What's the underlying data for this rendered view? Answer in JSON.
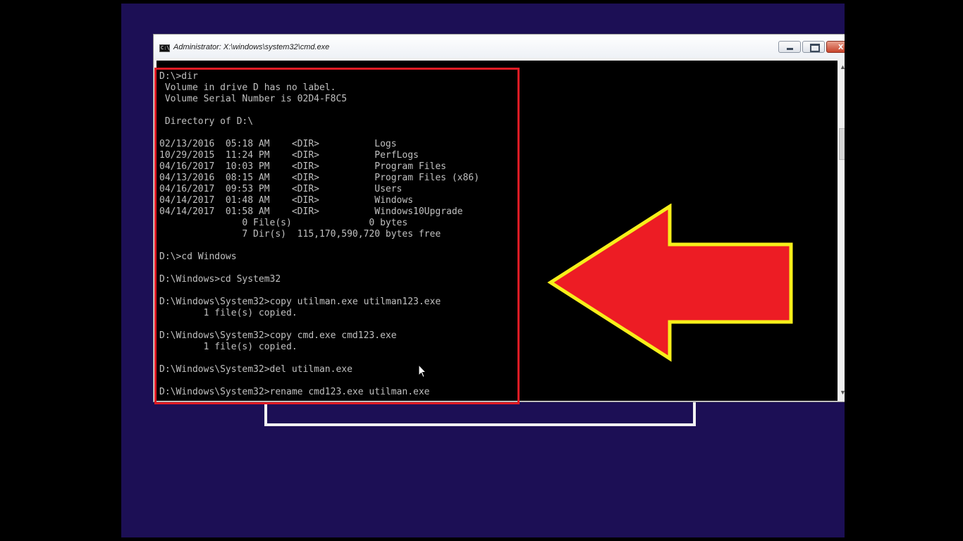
{
  "window": {
    "title": "Administrator: X:\\windows\\system32\\cmd.exe",
    "icon": "console-app-icon",
    "icon_text": "C:\\",
    "close_glyph": "x"
  },
  "console": {
    "lines": [
      "D:\\>dir",
      " Volume in drive D has no label.",
      " Volume Serial Number is 02D4-F8C5",
      "",
      " Directory of D:\\",
      "",
      "02/13/2016  05:18 AM    <DIR>          Logs",
      "10/29/2015  11:24 PM    <DIR>          PerfLogs",
      "04/16/2017  10:03 PM    <DIR>          Program Files",
      "04/13/2016  08:15 AM    <DIR>          Program Files (x86)",
      "04/16/2017  09:53 PM    <DIR>          Users",
      "04/14/2017  01:48 AM    <DIR>          Windows",
      "04/14/2017  01:58 AM    <DIR>          Windows10Upgrade",
      "               0 File(s)              0 bytes",
      "               7 Dir(s)  115,170,590,720 bytes free",
      "",
      "D:\\>cd Windows",
      "",
      "D:\\Windows>cd System32",
      "",
      "D:\\Windows\\System32>copy utilman.exe utilman123.exe",
      "        1 file(s) copied.",
      "",
      "D:\\Windows\\System32>copy cmd.exe cmd123.exe",
      "        1 file(s) copied.",
      "",
      "D:\\Windows\\System32>del utilman.exe",
      "",
      "D:\\Windows\\System32>rename cmd123.exe utilman.exe"
    ]
  },
  "colors": {
    "background": "#1c0f55",
    "console_bg": "#000000",
    "console_text": "#c0c0c0",
    "highlight": "#e01b24",
    "arrow_fill": "#ed1c24",
    "arrow_outline": "#f7ef1a"
  }
}
